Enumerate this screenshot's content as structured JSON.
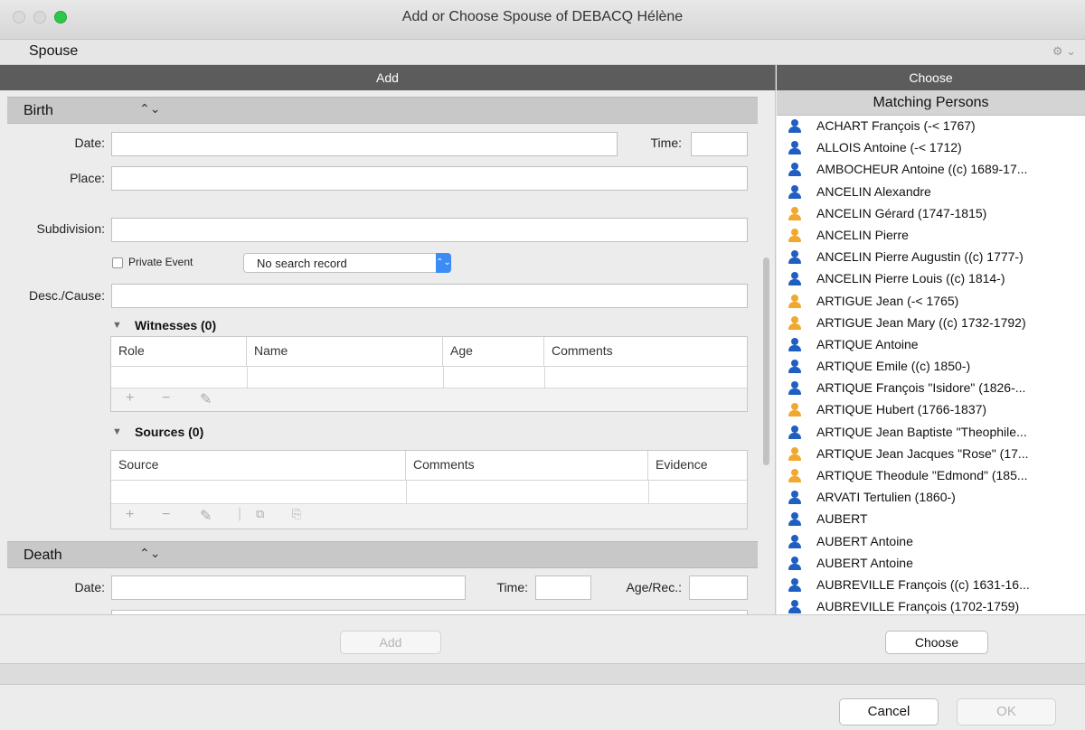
{
  "window": {
    "title": "Add or Choose Spouse of DEBACQ Hélène"
  },
  "spouse_bar": {
    "label": "Spouse",
    "gear_icon": "gear-icon"
  },
  "headers": {
    "add": "Add",
    "choose": "Choose"
  },
  "birth": {
    "title": "Birth",
    "date_label": "Date:",
    "time_label": "Time:",
    "place_label": "Place:",
    "subdivision_label": "Subdivision:",
    "private_label": "Private Event",
    "search_record": "No search record",
    "desc_label": "Desc./Cause:",
    "witnesses": {
      "title": "Witnesses (0)",
      "columns": [
        "Role",
        "Name",
        "Age",
        "Comments"
      ]
    },
    "sources": {
      "title": "Sources (0)",
      "columns": [
        "Source",
        "Comments",
        "Evidence"
      ]
    }
  },
  "death": {
    "title": "Death",
    "date_label": "Date:",
    "time_label": "Time:",
    "age_label": "Age/Rec.:"
  },
  "matching": {
    "title": "Matching Persons",
    "persons": [
      {
        "name": "ACHART François (-< 1767)",
        "gender": "male"
      },
      {
        "name": "ALLOIS Antoine (-< 1712)",
        "gender": "male"
      },
      {
        "name": "AMBOCHEUR Antoine ((c) 1689-17...",
        "gender": "male"
      },
      {
        "name": "ANCELIN Alexandre",
        "gender": "male"
      },
      {
        "name": "ANCELIN Gérard (1747-1815)",
        "gender": "female"
      },
      {
        "name": "ANCELIN Pierre",
        "gender": "female"
      },
      {
        "name": "ANCELIN Pierre Augustin ((c) 1777-)",
        "gender": "male"
      },
      {
        "name": "ANCELIN Pierre Louis ((c) 1814-)",
        "gender": "male"
      },
      {
        "name": "ARTIGUE Jean (-< 1765)",
        "gender": "female"
      },
      {
        "name": "ARTIGUE Jean Mary ((c) 1732-1792)",
        "gender": "female"
      },
      {
        "name": "ARTIQUE Antoine",
        "gender": "male"
      },
      {
        "name": "ARTIQUE Emile ((c) 1850-)",
        "gender": "male"
      },
      {
        "name": "ARTIQUE François \"Isidore\" (1826-...",
        "gender": "male"
      },
      {
        "name": "ARTIQUE Hubert (1766-1837)",
        "gender": "female"
      },
      {
        "name": "ARTIQUE Jean Baptiste \"Theophile...",
        "gender": "male"
      },
      {
        "name": "ARTIQUE Jean Jacques \"Rose\" (17...",
        "gender": "female"
      },
      {
        "name": "ARTIQUE Theodule \"Edmond\" (185...",
        "gender": "female"
      },
      {
        "name": "ARVATI Tertulien (1860-)",
        "gender": "male"
      },
      {
        "name": "AUBERT",
        "gender": "male"
      },
      {
        "name": "AUBERT Antoine",
        "gender": "male"
      },
      {
        "name": "AUBERT Antoine",
        "gender": "male"
      },
      {
        "name": "AUBREVILLE François ((c) 1631-16...",
        "gender": "male"
      },
      {
        "name": "AUBREVILLE François (1702-1759)",
        "gender": "male"
      }
    ]
  },
  "buttons": {
    "add": "Add",
    "choose": "Choose",
    "cancel": "Cancel",
    "ok": "OK"
  },
  "colors": {
    "male": "#1f5fc2",
    "female": "#f0a92e",
    "accent": "#3b8cf5"
  }
}
